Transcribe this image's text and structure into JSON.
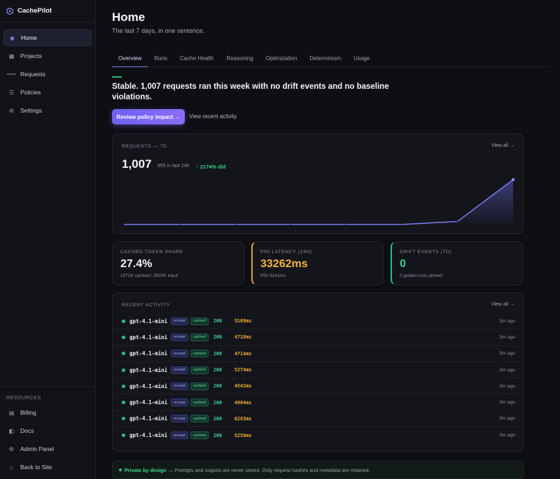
{
  "brand": {
    "name": "CachePilot"
  },
  "nav": {
    "items": [
      {
        "label": "Home",
        "icon": "circle-dot-icon"
      },
      {
        "label": "Projects",
        "icon": "grid-icon"
      },
      {
        "label": "Requests",
        "icon": "lines-icon"
      },
      {
        "label": "Policies",
        "icon": "list-icon"
      },
      {
        "label": "Settings",
        "icon": "gear-icon"
      }
    ],
    "resources_label": "RESOURCES",
    "resources": [
      {
        "label": "Billing",
        "icon": "card-icon"
      },
      {
        "label": "Docs",
        "icon": "book-icon"
      },
      {
        "label": "Admin Panel",
        "icon": "gear-icon"
      },
      {
        "label": "Back to Site",
        "icon": "house-icon"
      }
    ]
  },
  "header": {
    "title": "Home",
    "subtitle": "The last 7 days, in one sentence."
  },
  "tabs": [
    "Overview",
    "Runs",
    "Cache Health",
    "Reasoning",
    "Optimization",
    "Determinism",
    "Usage"
  ],
  "summary": {
    "headline": "Stable. 1,007 requests ran this week with no drift events and no baseline violations.",
    "primary_button": "Review policy impact →",
    "secondary_link": "View recent activity"
  },
  "requests_card": {
    "label": "REQUESTS — 7D",
    "view_all": "View all →",
    "total": "1,007",
    "last_24h": "955 in last 24h",
    "delta": "↑ 2174% d/d"
  },
  "chart_data": {
    "type": "area",
    "x": [
      1,
      2,
      3,
      4,
      5,
      6,
      7,
      8
    ],
    "values": [
      0,
      0,
      0,
      0,
      0,
      0,
      0.5,
      7.4
    ],
    "title": "",
    "xlabel": "",
    "ylabel": "",
    "grid": false,
    "line_color": "#7b7cf0"
  },
  "stats": [
    {
      "label": "CACHED TOKEN SHARE",
      "value": "27.4%",
      "sub": "1071K cached / 3915K input"
    },
    {
      "label": "P95 LATENCY (24H)",
      "value": "33262ms",
      "sub": "P50 6141ms"
    },
    {
      "label": "DRIFT EVENTS (7D)",
      "value": "0",
      "sub": "0 golden runs pinned"
    }
  ],
  "activity": {
    "label": "RECENT ACTIVITY",
    "view_all": "View all →",
    "rows": [
      {
        "model": "gpt-4.1-mini",
        "tag1": "receipt",
        "tag2": "cached",
        "status": "200",
        "latency": "5108ms",
        "ago": "3m ago"
      },
      {
        "model": "gpt-4.1-mini",
        "tag1": "receipt",
        "tag2": "cached",
        "status": "200",
        "latency": "4718ms",
        "ago": "3m ago"
      },
      {
        "model": "gpt-4.1-mini",
        "tag1": "receipt",
        "tag2": "cached",
        "status": "200",
        "latency": "4714ms",
        "ago": "3m ago"
      },
      {
        "model": "gpt-4.1-mini",
        "tag1": "receipt",
        "tag2": "cached",
        "status": "200",
        "latency": "5274ms",
        "ago": "3m ago"
      },
      {
        "model": "gpt-4.1-mini",
        "tag1": "receipt",
        "tag2": "cached",
        "status": "200",
        "latency": "4542ms",
        "ago": "3m ago"
      },
      {
        "model": "gpt-4.1-mini",
        "tag1": "receipt",
        "tag2": "cached",
        "status": "200",
        "latency": "4904ms",
        "ago": "3m ago"
      },
      {
        "model": "gpt-4.1-mini",
        "tag1": "receipt",
        "tag2": "cached",
        "status": "200",
        "latency": "6283ms",
        "ago": "3m ago"
      },
      {
        "model": "gpt-4.1-mini",
        "tag1": "receipt",
        "tag2": "cached",
        "status": "200",
        "latency": "5250ms",
        "ago": "3m ago"
      }
    ]
  },
  "privacy": {
    "title": "Private by design",
    "text": "— Prompts and outputs are never stored. Only request hashes and metadata are retained."
  }
}
